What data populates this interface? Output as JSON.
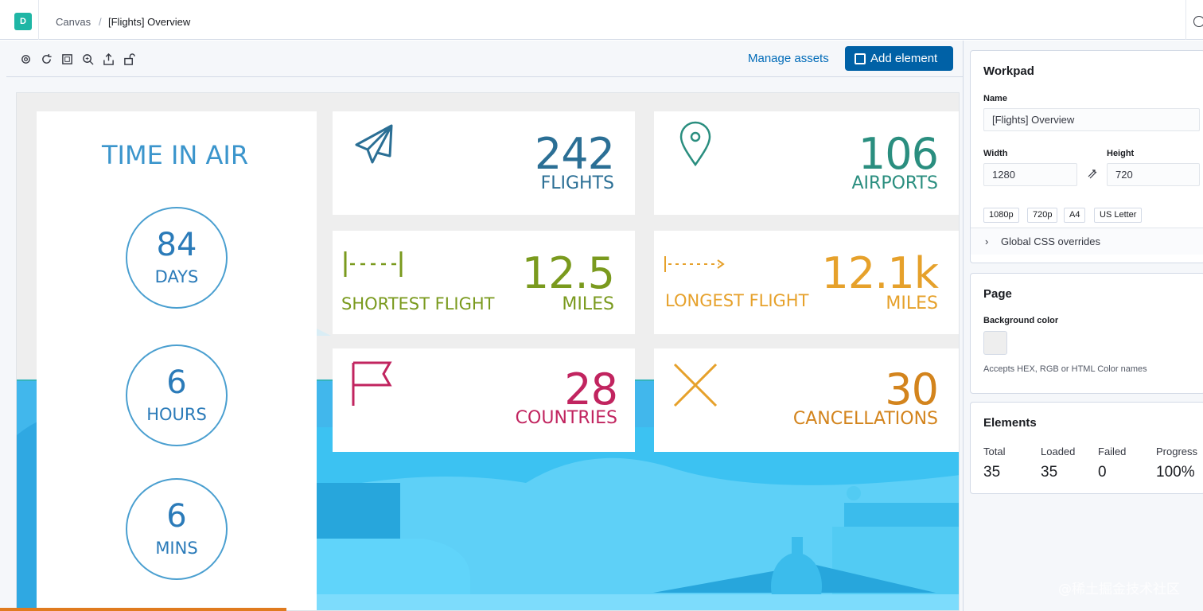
{
  "topbar": {
    "logo_letter": "D",
    "crumb_canvas": "Canvas",
    "crumb_separator": "/",
    "crumb_workpad": "[Flights] Overview"
  },
  "toolbar": {
    "icons": [
      "gear-icon",
      "refresh-icon",
      "fullscreen-icon",
      "zoom-icon",
      "share-icon",
      "lock-icon"
    ],
    "manage_assets": "Manage assets",
    "add_element": "Add element"
  },
  "canvas": {
    "time_in_air": {
      "title": "TIME IN AIR",
      "days_value": "84",
      "days_label": "DAYS",
      "hours_value": "6",
      "hours_label": "HOURS",
      "mins_value": "6",
      "mins_label": "MINS"
    },
    "flights": {
      "value": "242",
      "label": "FLIGHTS",
      "icon": "airplane-icon",
      "color": "#2b6f95"
    },
    "airports": {
      "value": "106",
      "label": "AIRPORTS",
      "icon": "map-pin-icon",
      "color": "#2a8e7f"
    },
    "shortest": {
      "value": "12.5",
      "label": "MILES",
      "caption": "SHORTEST FLIGHT",
      "icon": "short-distance-icon",
      "color": "#7a9a1e"
    },
    "longest": {
      "value": "12.1k",
      "label": "MILES",
      "caption": "LONGEST FLIGHT",
      "icon": "long-distance-icon",
      "color": "#e6a12b"
    },
    "countries": {
      "value": "28",
      "label": "COUNTRIES",
      "icon": "flag-icon",
      "color": "#c1245f"
    },
    "cancellations": {
      "value": "30",
      "label": "CANCELLATIONS",
      "icon": "cross-icon",
      "color": "#d3841d"
    }
  },
  "sidebar": {
    "workpad": {
      "title": "Workpad",
      "name_label": "Name",
      "name_value": "[Flights] Overview",
      "width_label": "Width",
      "width_value": "1280",
      "height_label": "Height",
      "height_value": "720",
      "presets": [
        "1080p",
        "720p",
        "A4",
        "US Letter"
      ],
      "css_overrides": "Global CSS overrides"
    },
    "page": {
      "title": "Page",
      "bg_label": "Background color",
      "bg_hint": "Accepts HEX, RGB or HTML Color names"
    },
    "elements": {
      "title": "Elements",
      "stats": [
        {
          "label": "Total",
          "value": "35"
        },
        {
          "label": "Loaded",
          "value": "35"
        },
        {
          "label": "Failed",
          "value": "0"
        },
        {
          "label": "Progress",
          "value": "100%"
        }
      ]
    }
  },
  "watermark": "@稀土掘金技术社区"
}
